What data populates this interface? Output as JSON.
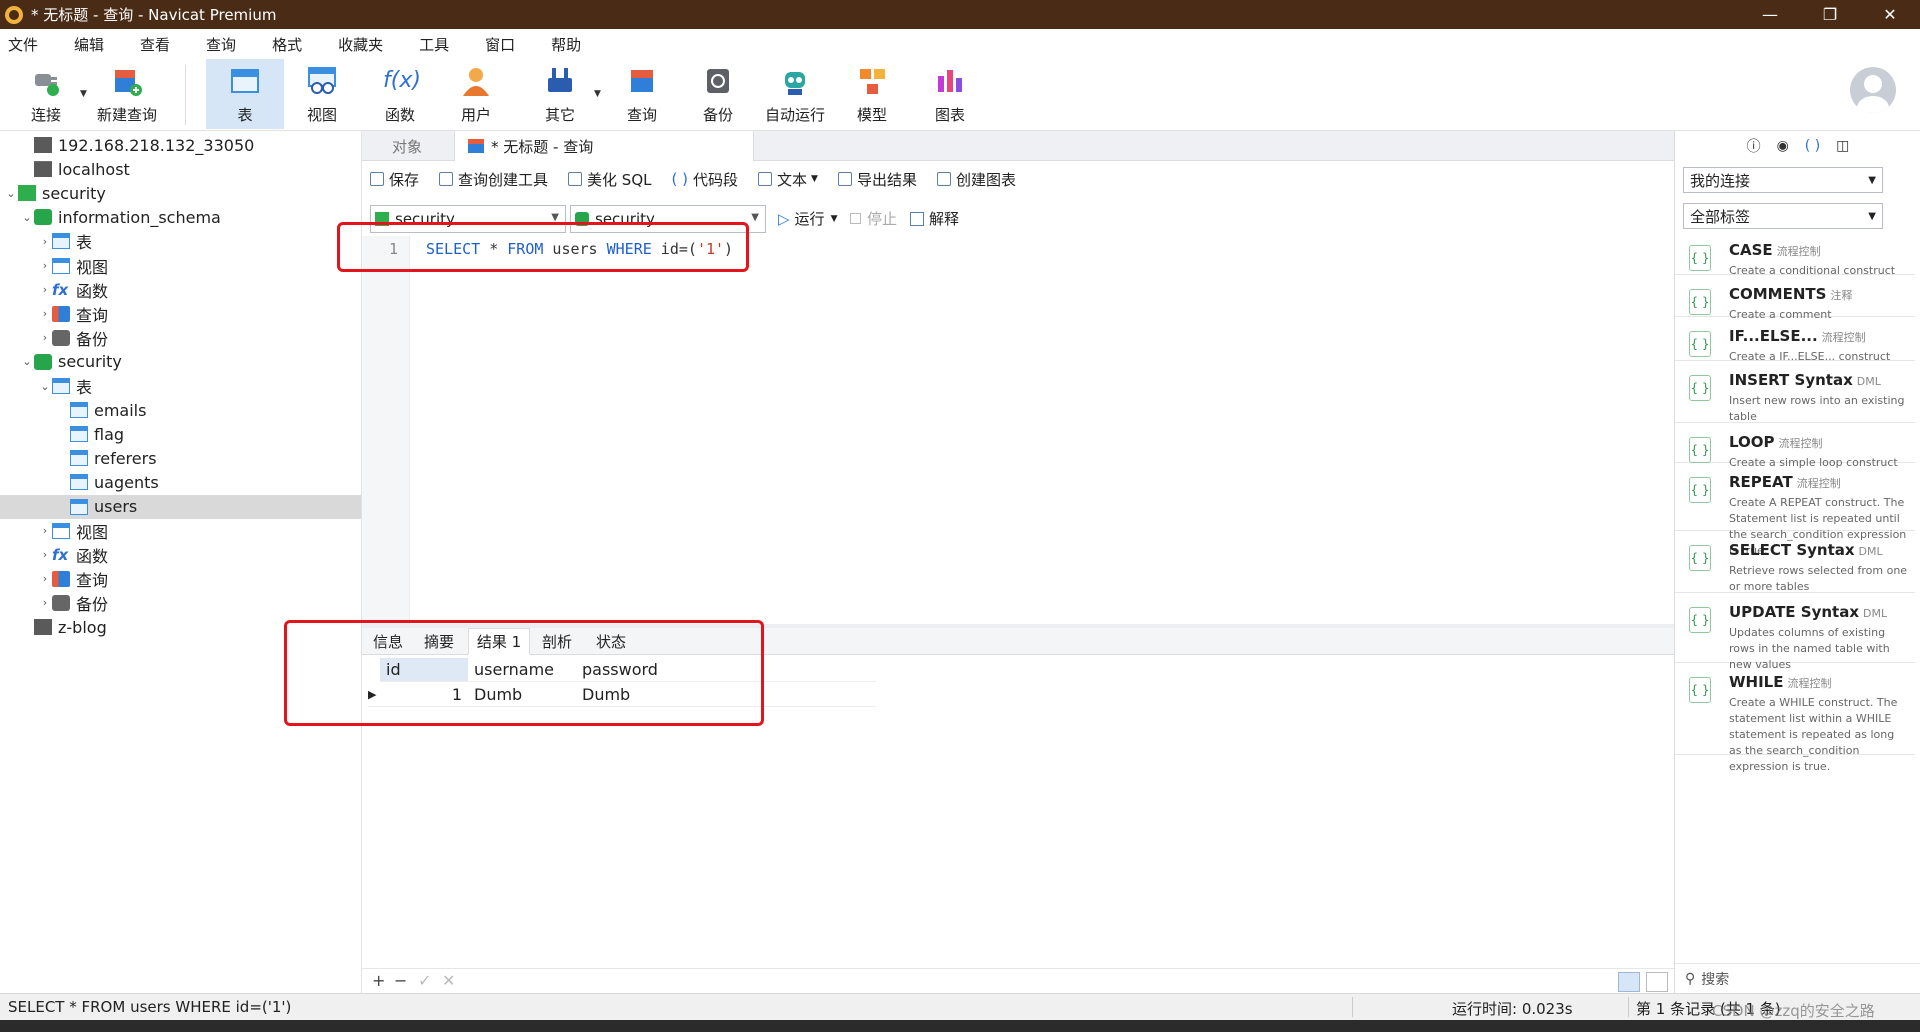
{
  "window": {
    "title": "* 无标题 - 查询 - Navicat Premium",
    "controls": [
      "—",
      "❐",
      "✕"
    ]
  },
  "menubar": [
    "文件",
    "编辑",
    "查看",
    "查询",
    "格式",
    "收藏夹",
    "工具",
    "窗口",
    "帮助"
  ],
  "toolbar": {
    "connect": "连接",
    "new_query": "新建查询",
    "table": "表",
    "view": "视图",
    "function": "函数",
    "user": "用户",
    "other": "其它",
    "query": "查询",
    "backup": "备份",
    "autorun": "自动运行",
    "model": "模型",
    "chart": "图表",
    "func_glyph": "f(x)"
  },
  "tree": {
    "items": [
      {
        "label": "192.168.218.132_33050",
        "icon": "connection-icon"
      },
      {
        "label": "localhost",
        "icon": "connection-icon"
      },
      {
        "label": "security",
        "icon": "connection-icon",
        "expanded": true
      },
      {
        "label": "information_schema",
        "icon": "database-icon",
        "expanded": true
      },
      {
        "label": "表",
        "icon": "table-icon"
      },
      {
        "label": "视图",
        "icon": "view-icon"
      },
      {
        "label": "函数",
        "icon": "function-icon"
      },
      {
        "label": "查询",
        "icon": "query-icon"
      },
      {
        "label": "备份",
        "icon": "backup-icon"
      },
      {
        "label": "security",
        "icon": "database-icon",
        "expanded": true
      },
      {
        "label": "表",
        "icon": "table-icon",
        "expanded": true
      },
      {
        "label": "emails",
        "icon": "table-icon"
      },
      {
        "label": "flag",
        "icon": "table-icon"
      },
      {
        "label": "referers",
        "icon": "table-icon"
      },
      {
        "label": "uagents",
        "icon": "table-icon"
      },
      {
        "label": "users",
        "icon": "table-icon",
        "selected": true
      },
      {
        "label": "视图",
        "icon": "view-icon"
      },
      {
        "label": "函数",
        "icon": "function-icon"
      },
      {
        "label": "查询",
        "icon": "query-icon"
      },
      {
        "label": "备份",
        "icon": "backup-icon"
      },
      {
        "label": "z-blog",
        "icon": "connection-icon"
      }
    ]
  },
  "tabs": {
    "objects": "对象",
    "query": "* 无标题 - 查询"
  },
  "query_toolbar": {
    "save": "保存",
    "builder": "查询创建工具",
    "beautify": "美化 SQL",
    "snippet": "代码段",
    "text": "文本",
    "export": "导出结果",
    "create_chart": "创建图表"
  },
  "run_bar": {
    "connection": "security",
    "database": "security",
    "run": "运行",
    "stop": "停止",
    "explain": "解释"
  },
  "editor": {
    "line_number": "1",
    "tokens": {
      "select": "SELECT",
      "star": " * ",
      "from": "FROM",
      "table": " users ",
      "where": "WHERE",
      "cond": " id=(",
      "value": "'1'",
      "close": ")"
    }
  },
  "result": {
    "tabs": [
      "信息",
      "摘要",
      "结果 1",
      "剖析",
      "状态"
    ],
    "active_tab": "结果 1",
    "columns": [
      "id",
      "username",
      "password"
    ],
    "rows": [
      [
        "1",
        "Dumb",
        "Dumb"
      ]
    ]
  },
  "result_footer": {
    "add": "+",
    "remove": "−",
    "apply": "✓",
    "cancel": "✕"
  },
  "right_panel": {
    "connection_filter": "我的连接",
    "tag_filter": "全部标签",
    "snippets": [
      {
        "name": "CASE",
        "category": "流程控制",
        "desc": "Create a conditional construct"
      },
      {
        "name": "COMMENTS",
        "category": "注释",
        "desc": "Create a comment"
      },
      {
        "name": "IF...ELSE...",
        "category": "流程控制",
        "desc": "Create a IF...ELSE... construct"
      },
      {
        "name": "INSERT Syntax",
        "category": "DML",
        "desc": "Insert new rows into an existing table"
      },
      {
        "name": "LOOP",
        "category": "流程控制",
        "desc": "Create a simple loop construct"
      },
      {
        "name": "REPEAT",
        "category": "流程控制",
        "desc": "Create A REPEAT construct. The Statement list is repeated until the search_condition expression is true."
      },
      {
        "name": "SELECT Syntax",
        "category": "DML",
        "desc": "Retrieve rows selected from one or more tables"
      },
      {
        "name": "UPDATE Syntax",
        "category": "DML",
        "desc": "Updates columns of existing rows in the named table with new values"
      },
      {
        "name": "WHILE",
        "category": "流程控制",
        "desc": "Create a WHILE construct. The statement list within a WHILE statement is repeated as long as the search_condition expression is true."
      }
    ],
    "search_placeholder": "搜索"
  },
  "statusbar": {
    "sql": "SELECT * FROM users WHERE id=('1')",
    "run_time": "运行时间: 0.023s",
    "record": "第 1 条记录 (共 1 条)",
    "watermark": "CSDN @zzq的安全之路"
  },
  "colors": {
    "titlebar": "#4a2c16",
    "highlight_box": "#e3141b",
    "keyword": "#1d5fcf",
    "string": "#c0392b",
    "active_tool": "#d6e6f7"
  }
}
